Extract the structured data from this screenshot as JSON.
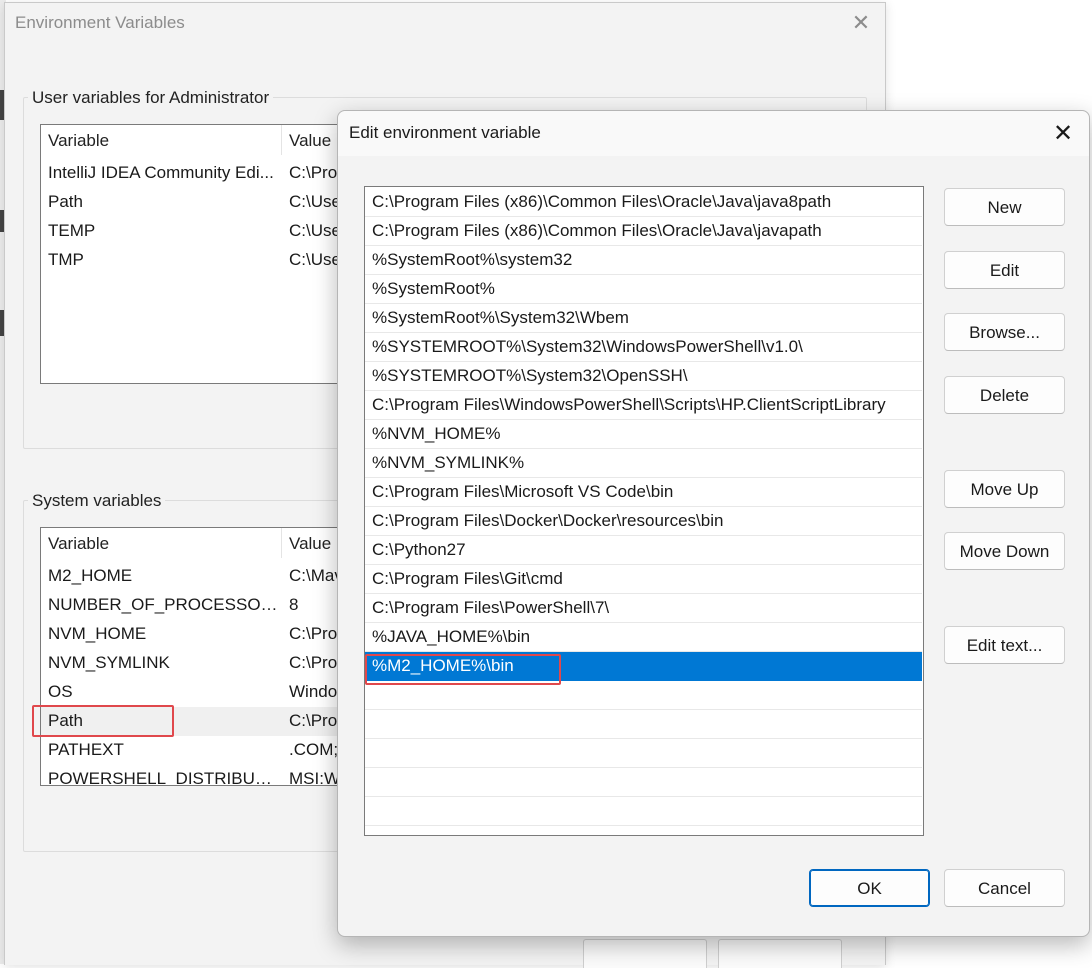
{
  "env_window": {
    "title": "Environment Variables",
    "close_glyph": "✕",
    "user_vars": {
      "group_title": "User variables for Administrator",
      "headers": [
        "Variable",
        "Value"
      ],
      "rows": [
        {
          "variable": "IntelliJ IDEA Community Edi...",
          "value": "C:\\Pro"
        },
        {
          "variable": "Path",
          "value": "C:\\Use"
        },
        {
          "variable": "TEMP",
          "value": "C:\\Use"
        },
        {
          "variable": "TMP",
          "value": "C:\\Use"
        }
      ]
    },
    "system_vars": {
      "group_title": "System variables",
      "headers": [
        "Variable",
        "Value"
      ],
      "rows": [
        {
          "variable": "M2_HOME",
          "value": "C:\\Mav"
        },
        {
          "variable": "NUMBER_OF_PROCESSORS",
          "value": "8"
        },
        {
          "variable": "NVM_HOME",
          "value": "C:\\Pro"
        },
        {
          "variable": "NVM_SYMLINK",
          "value": "C:\\Pro"
        },
        {
          "variable": "OS",
          "value": "Windo"
        },
        {
          "variable": "Path",
          "value": "C:\\Pro"
        },
        {
          "variable": "PATHEXT",
          "value": ".COM;"
        },
        {
          "variable": "POWERSHELL_DISTRIBUTIO...",
          "value": "MSI:W"
        }
      ],
      "selected_variable": "Path"
    }
  },
  "edit_dialog": {
    "title": "Edit environment variable",
    "close_glyph": "✕",
    "entries": [
      "C:\\Program Files (x86)\\Common Files\\Oracle\\Java\\java8path",
      "C:\\Program Files (x86)\\Common Files\\Oracle\\Java\\javapath",
      "%SystemRoot%\\system32",
      "%SystemRoot%",
      "%SystemRoot%\\System32\\Wbem",
      "%SYSTEMROOT%\\System32\\WindowsPowerShell\\v1.0\\",
      "%SYSTEMROOT%\\System32\\OpenSSH\\",
      "C:\\Program Files\\WindowsPowerShell\\Scripts\\HP.ClientScriptLibrary",
      "%NVM_HOME%",
      "%NVM_SYMLINK%",
      "C:\\Program Files\\Microsoft VS Code\\bin",
      "C:\\Program Files\\Docker\\Docker\\resources\\bin",
      "C:\\Python27",
      "C:\\Program Files\\Git\\cmd",
      "C:\\Program Files\\PowerShell\\7\\",
      "%JAVA_HOME%\\bin",
      "%M2_HOME%\\bin"
    ],
    "selected_entry": "%M2_HOME%\\bin",
    "buttons": {
      "new": "New",
      "edit": "Edit",
      "browse": "Browse...",
      "delete": "Delete",
      "move_up": "Move Up",
      "move_down": "Move Down",
      "edit_text": "Edit text...",
      "ok": "OK",
      "cancel": "Cancel"
    }
  },
  "colors": {
    "selection": "#0078d4",
    "highlight_box": "#e0484c",
    "ok_border": "#0067c0"
  }
}
